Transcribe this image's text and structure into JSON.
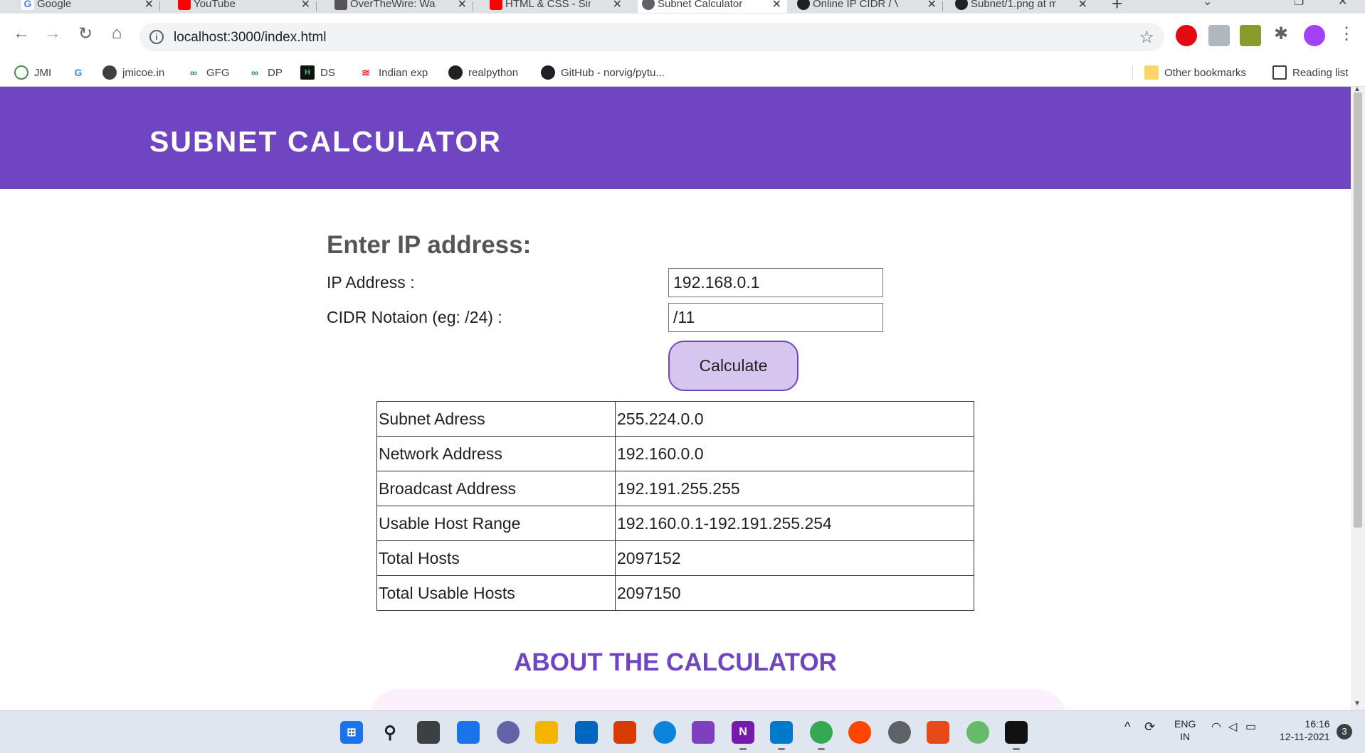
{
  "tabs": [
    {
      "title": "Google",
      "color": "#ffffff"
    },
    {
      "title": "YouTube",
      "color": "#ff0000"
    },
    {
      "title": "OverTheWire: Warg",
      "color": "#555555"
    },
    {
      "title": "HTML & CSS - Simp",
      "color": "#ff0000"
    },
    {
      "title": "Subnet Calculator",
      "color": "#5f6368"
    },
    {
      "title": "Online IP CIDR / VL",
      "color": "#202124"
    },
    {
      "title": "Subnet/1.png at m",
      "color": "#202124"
    }
  ],
  "toolbar": {
    "url": "localhost:3000/index.html"
  },
  "bookmarks": [
    {
      "label": "JMI",
      "icon": "jmi-icon"
    },
    {
      "label": "",
      "icon": "google-icon"
    },
    {
      "label": "jmicoe.in",
      "icon": "globe-icon"
    },
    {
      "label": "GFG",
      "icon": "gfg-icon"
    },
    {
      "label": "DP",
      "icon": "gfg-icon"
    },
    {
      "label": "DS",
      "icon": "hackerrank-icon"
    },
    {
      "label": "Indian exp",
      "icon": "indian-express-icon"
    },
    {
      "label": "realpython",
      "icon": "github-icon"
    },
    {
      "label": "GitHub - norvig/pytu...",
      "icon": "github-icon"
    }
  ],
  "bookmarks_right": {
    "other": "Other bookmarks",
    "reading": "Reading list"
  },
  "page": {
    "header": "SUBNET CALCULATOR",
    "form_title": "Enter IP address:",
    "ip_label": "IP Address :",
    "ip_value": "192.168.0.1",
    "cidr_label": "CIDR Notaion (eg: /24) :",
    "cidr_value": "/11",
    "calculate_label": "Calculate",
    "results": [
      {
        "key": "Subnet Adress",
        "value": "255.224.0.0"
      },
      {
        "key": "Network Address",
        "value": "192.160.0.0"
      },
      {
        "key": "Broadcast Address",
        "value": "192.191.255.255"
      },
      {
        "key": "Usable Host Range",
        "value": "192.160.0.1-192.191.255.254"
      },
      {
        "key": "Total Hosts",
        "value": "2097152"
      },
      {
        "key": "Total Usable Hosts",
        "value": "2097150"
      }
    ],
    "about_title": "ABOUT THE CALCULATOR",
    "accent_color": "#7045c2"
  },
  "taskbar": {
    "lang_top": "ENG",
    "lang_bottom": "IN",
    "time": "16:16",
    "date": "12-11-2021",
    "notif_count": "3"
  }
}
